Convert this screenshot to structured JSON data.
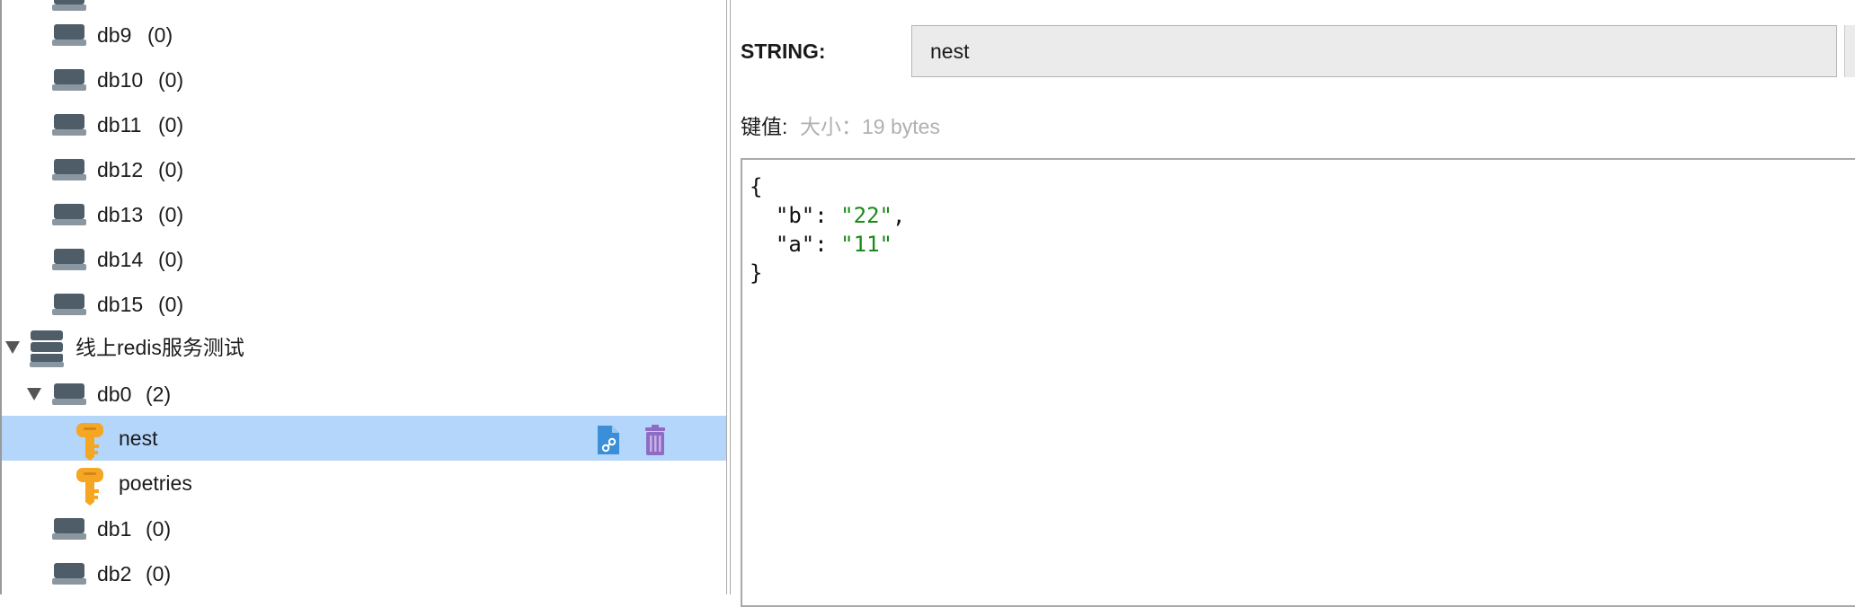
{
  "tree": {
    "items": [
      {
        "kind": "db",
        "name": "db9",
        "count": "(0)"
      },
      {
        "kind": "db",
        "name": "db10",
        "count": "(0)"
      },
      {
        "kind": "db",
        "name": "db11",
        "count": "(0)"
      },
      {
        "kind": "db",
        "name": "db12",
        "count": "(0)"
      },
      {
        "kind": "db",
        "name": "db13",
        "count": "(0)"
      },
      {
        "kind": "db",
        "name": "db14",
        "count": "(0)"
      },
      {
        "kind": "db",
        "name": "db15",
        "count": "(0)"
      },
      {
        "kind": "server",
        "name": "线上redis服务测试"
      },
      {
        "kind": "db",
        "name": "db0",
        "count": "(2)"
      },
      {
        "kind": "key",
        "name": "nest"
      },
      {
        "kind": "key",
        "name": "poetries"
      },
      {
        "kind": "db",
        "name": "db1",
        "count": "(0)"
      },
      {
        "kind": "db",
        "name": "db2",
        "count": "(0)"
      }
    ]
  },
  "detail": {
    "type_label": "STRING:",
    "key_name": "nest",
    "value_label": "键值:",
    "size_label": "大小：19 bytes",
    "json_value": {
      "open": "{",
      "b_key": "\"b\"",
      "b_val": "\"22\"",
      "a_key": "\"a\"",
      "a_val": "\"11\"",
      "close": "}"
    }
  },
  "colors": {
    "selection": "#b4d6fb",
    "key_icon": "#f5a623",
    "db_icon": "#4f5d69",
    "delete_icon": "#8e6bc4",
    "copy_icon": "#3a8fd8",
    "json_string": "#1a8a1a"
  },
  "icons": {
    "db": "database-icon",
    "server": "server-stack-icon",
    "key": "key-icon",
    "copy": "copy-link-icon",
    "delete": "trash-icon"
  }
}
